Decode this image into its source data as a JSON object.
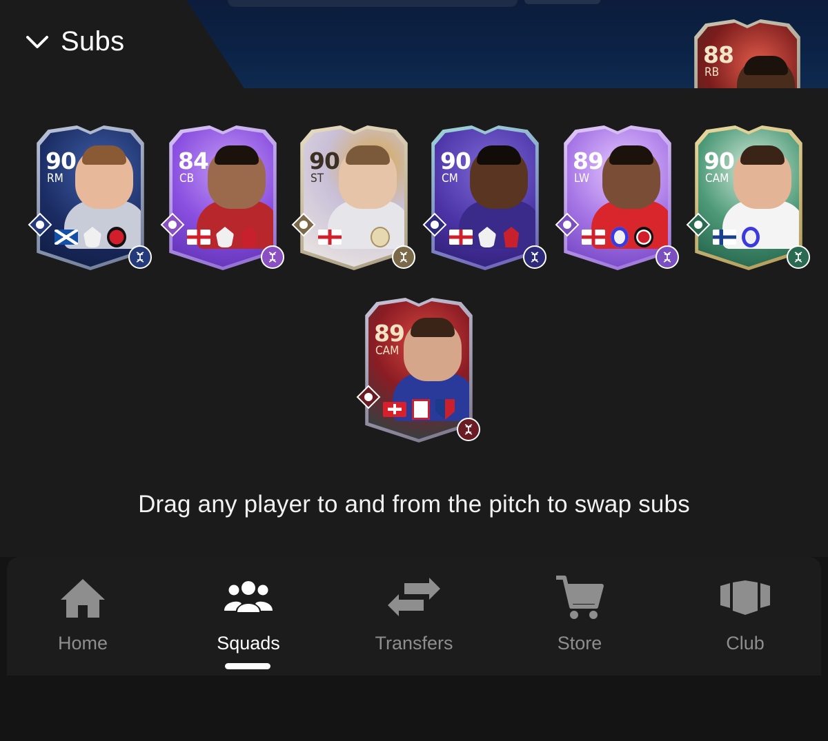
{
  "header": {
    "title": "Subs",
    "collapse_icon": "chevron-down-icon"
  },
  "pitch_card": {
    "rating": "88",
    "position": "RB"
  },
  "subs": [
    {
      "rating": "90",
      "position": "RM",
      "theme": "blue",
      "flag": "scotland",
      "league": "premier-league",
      "club": "bournemouth"
    },
    {
      "rating": "84",
      "position": "CB",
      "theme": "purple",
      "flag": "england",
      "league": "premier-league",
      "club": "liverpool"
    },
    {
      "rating": "90",
      "position": "ST",
      "theme": "icon-gold",
      "flag": "england",
      "league": "icons",
      "club": "icon"
    },
    {
      "rating": "90",
      "position": "CM",
      "theme": "violet",
      "flag": "england",
      "league": "premier-league",
      "club": "liverpool"
    },
    {
      "rating": "89",
      "position": "LW",
      "theme": "lilac",
      "flag": "england",
      "league": "eredivisie",
      "club": "feyenoord"
    },
    {
      "rating": "90",
      "position": "CAM",
      "theme": "green",
      "flag": "finland",
      "league": "eredivisie",
      "club": "none"
    },
    {
      "rating": "89",
      "position": "CAM",
      "theme": "winter-red",
      "flag": "switzerland",
      "league": "super-league",
      "club": "basel"
    }
  ],
  "hint_text": "Drag any player to and from the pitch to swap subs",
  "nav": {
    "items": [
      {
        "label": "Home",
        "icon": "home-icon"
      },
      {
        "label": "Squads",
        "icon": "users-icon"
      },
      {
        "label": "Transfers",
        "icon": "transfer-arrows-icon"
      },
      {
        "label": "Store",
        "icon": "cart-icon"
      },
      {
        "label": "Club",
        "icon": "club-icon"
      }
    ],
    "active": "Squads"
  },
  "colors": {
    "panel": "#1b1b1b",
    "nav_bg": "#1c1c1c",
    "nav_inactive": "#8e8e8e",
    "nav_active": "#ffffff"
  }
}
